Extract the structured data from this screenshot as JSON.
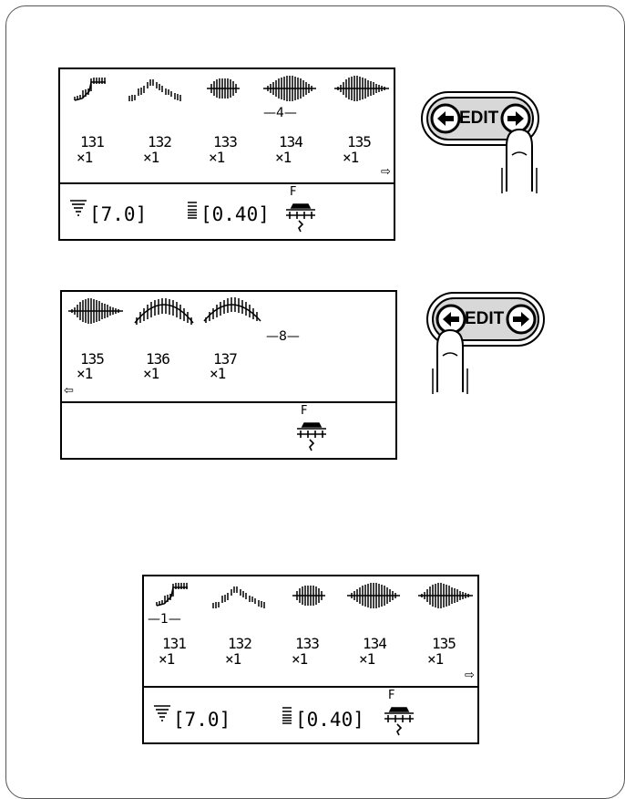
{
  "panel1": {
    "numbers": [
      "131",
      "132",
      "133",
      "134",
      "135"
    ],
    "multipliers": [
      "×1",
      "×1",
      "×1",
      "×1",
      "×1"
    ],
    "count_label": "—4—",
    "width_value": "[7.0]",
    "length_value": "[0.40]",
    "presser_label": "F",
    "scroll_arrow": "⇨"
  },
  "panel2": {
    "numbers": [
      "135",
      "136",
      "137"
    ],
    "multipliers": [
      "×1",
      "×1",
      "×1"
    ],
    "count_label": "—8—",
    "presser_label": "F",
    "scroll_arrow": "⇦"
  },
  "panel3": {
    "numbers": [
      "131",
      "132",
      "133",
      "134",
      "135"
    ],
    "multipliers": [
      "×1",
      "×1",
      "×1",
      "×1",
      "×1"
    ],
    "count_label": "—1—",
    "width_value": "[7.0]",
    "length_value": "[0.40]",
    "presser_label": "F",
    "scroll_arrow": "⇨"
  },
  "edit_button": {
    "label": "EDIT",
    "icons": [
      "left-arrow-icon",
      "right-arrow-icon"
    ]
  },
  "stitch_icons": [
    "stitch-131-icon",
    "stitch-132-icon",
    "stitch-133-icon",
    "stitch-134-icon",
    "stitch-135-icon",
    "stitch-136-icon",
    "stitch-137-icon"
  ]
}
